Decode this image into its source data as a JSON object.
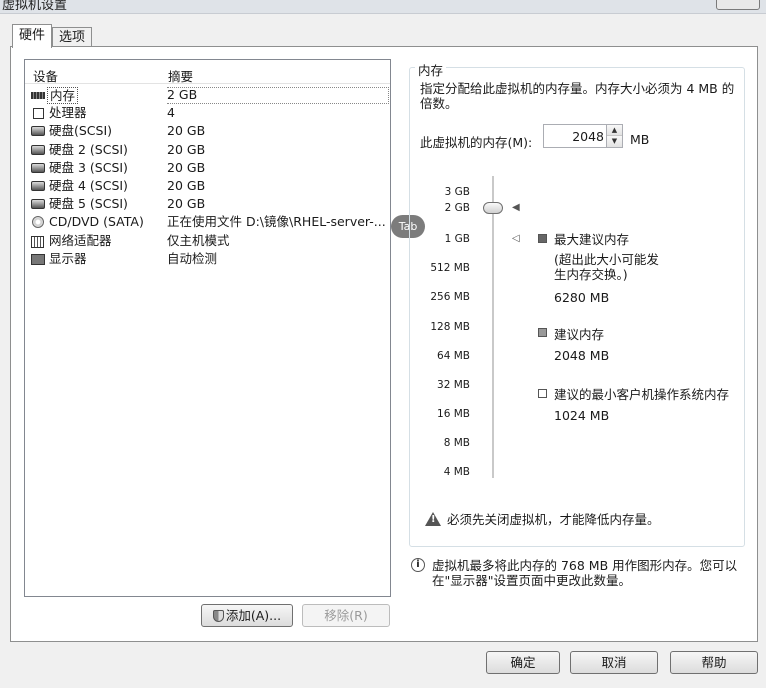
{
  "window": {
    "title": "虚拟机设置"
  },
  "tabs": [
    {
      "label": "硬件"
    },
    {
      "label": "选项"
    }
  ],
  "device_table": {
    "headers": {
      "device": "设备",
      "summary": "摘要"
    },
    "rows": [
      {
        "name": "内存",
        "summary": "2 GB",
        "icon": "memory-icon"
      },
      {
        "name": "处理器",
        "summary": "4",
        "icon": "processor-icon"
      },
      {
        "name": "硬盘(SCSI)",
        "summary": "20 GB",
        "icon": "disk-icon"
      },
      {
        "name": "硬盘 2 (SCSI)",
        "summary": "20 GB",
        "icon": "disk-icon"
      },
      {
        "name": "硬盘 3 (SCSI)",
        "summary": "20 GB",
        "icon": "disk-icon"
      },
      {
        "name": "硬盘 4 (SCSI)",
        "summary": "20 GB",
        "icon": "disk-icon"
      },
      {
        "name": "硬盘 5 (SCSI)",
        "summary": "20 GB",
        "icon": "disk-icon"
      },
      {
        "name": "CD/DVD (SATA)",
        "summary": "正在使用文件 D:\\镜像\\RHEL-server-...",
        "icon": "cd-dvd-icon"
      },
      {
        "name": "网络适配器",
        "summary": "仅主机模式",
        "icon": "network-adapter-icon"
      },
      {
        "name": "显示器",
        "summary": "自动检测",
        "icon": "monitor-icon"
      }
    ]
  },
  "buttons": {
    "add": "添加(A)...",
    "remove": "移除(R)",
    "ok": "确定",
    "cancel": "取消",
    "help": "帮助"
  },
  "tab_tooltip": "Tab",
  "memory": {
    "group_title": "内存",
    "description": "指定分配给此虚拟机的内存量。内存大小必须为 4 MB 的倍数。",
    "field_label": "此虚拟机的内存(M):",
    "value": "2048",
    "unit": "MB",
    "scale_labels": [
      "3 GB",
      "2 GB",
      "1 GB",
      "512 MB",
      "256 MB",
      "128 MB",
      "64 MB",
      "32 MB",
      "16 MB",
      "8 MB",
      "4 MB"
    ],
    "legend": {
      "max_title": "最大建议内存",
      "max_note": "(超出此大小可能发生内存交换。)",
      "max_value": "6280 MB",
      "recommended_title": "建议内存",
      "recommended_value": "2048 MB",
      "min_title": "建议的最小客户机操作系统内存",
      "min_value": "1024 MB"
    },
    "warning": "必须先关闭虚拟机，才能降低内存量。",
    "info": "虚拟机最多将此内存的 768 MB 用作图形内存。您可以在\"显示器\"设置页面中更改此数量。"
  },
  "colors": {
    "panel_bg": "#ffffff",
    "window_bg": "#f0f0f0",
    "border": "#8e8f8f"
  }
}
